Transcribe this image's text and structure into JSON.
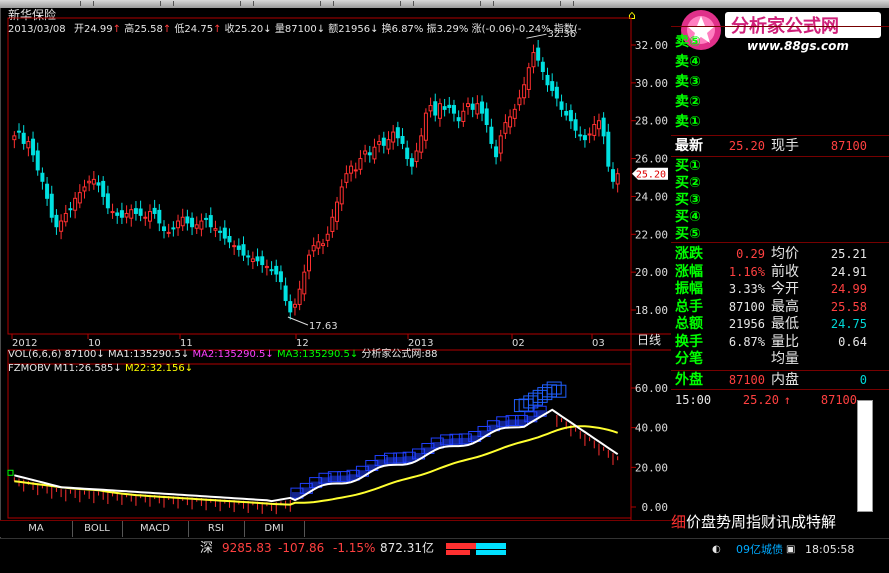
{
  "stock": {
    "name": "新华保险",
    "date": "2013/03/08",
    "open_label": "开24.99",
    "high_label": "高25.58",
    "low_label": "低24.75",
    "close_label": "收25.20",
    "volume_label": "量87100",
    "amount_label": "额21956",
    "turnover_label": "换6.87%",
    "amplitude_label": "振3.29%",
    "change_label": "涨(-0.06)-0.24%",
    "index_label": "指数(-",
    "arrow_up": "↑",
    "arrow_down": "↓"
  },
  "price_axis": {
    "ticks": [
      "32.00",
      "30.00",
      "28.00",
      "26.00",
      "24.00",
      "22.00",
      "20.00",
      "18.00"
    ],
    "current": "25.20",
    "max_marker": "32.36",
    "min_marker": "17.63"
  },
  "date_axis": {
    "labels": [
      "2012",
      "10",
      "11",
      "12",
      "2013",
      "02",
      "03"
    ],
    "period": "日线"
  },
  "vol_legend": {
    "prefix": "VOL(6,6,6)",
    "vol": "87100",
    "ma1": "MA1:135290.5",
    "ma2": "MA2:135290.5",
    "ma3": "MA3:135290.5",
    "site": "分析家公式网:88"
  },
  "indicator": {
    "name": "FZMOBV",
    "m11": "M11:26.585",
    "m22": "M22:32.156",
    "ticks": [
      "60.00",
      "40.00",
      "20.00",
      "0.00"
    ]
  },
  "tabs": [
    "MA",
    "BOLL",
    "MACD",
    "RSI",
    "DMI"
  ],
  "logo": {
    "title": "分析家公式网",
    "url": "www.88gs.com"
  },
  "orderbook": {
    "sell": [
      "卖⑤",
      "卖④",
      "卖③",
      "卖②",
      "卖①"
    ],
    "buy": [
      "买①",
      "买②",
      "买③",
      "买④",
      "买⑤"
    ]
  },
  "quote": {
    "latest_label": "最新",
    "latest": "25.20",
    "hand_label": "现手",
    "hand": "87100",
    "change_label": "涨跌",
    "change": "0.29",
    "avg_label": "均价",
    "avg": "25.21",
    "pct_label": "涨幅",
    "pct": "1.16%",
    "prev_label": "前收",
    "prev": "24.91",
    "amp_label": "振幅",
    "amp": "3.33%",
    "open_label": "今开",
    "open": "24.99",
    "total_label": "总手",
    "total": "87100",
    "high_label": "最高",
    "high": "25.58",
    "amount_label": "总额",
    "amount": "21956",
    "low_label": "最低",
    "low": "24.75",
    "turn_label": "换手",
    "turn": "6.87%",
    "ratio_label": "量比",
    "ratio": "0.64",
    "fen_label": "分笔",
    "avgvol_label": "均量",
    "outer_label": "外盘",
    "outer": "87100",
    "inner_label": "内盘",
    "inner": "0"
  },
  "tick": {
    "time": "15:00",
    "price": "25.20",
    "arrow": "↑",
    "vol": "87100"
  },
  "right_tabs": "细价盘势周指财讯成特解",
  "status": {
    "market": "深",
    "index": "9285.83",
    "change": "-107.86",
    "pct": "-1.15%",
    "amount": "872.31亿",
    "news": "09亿城债",
    "time": "18:05:58"
  },
  "colors": {
    "up": "#ff4040",
    "down": "#00d8d8",
    "grid": "#7a0000",
    "white_line": "#ffffff",
    "yellow_line": "#ffff00"
  }
}
